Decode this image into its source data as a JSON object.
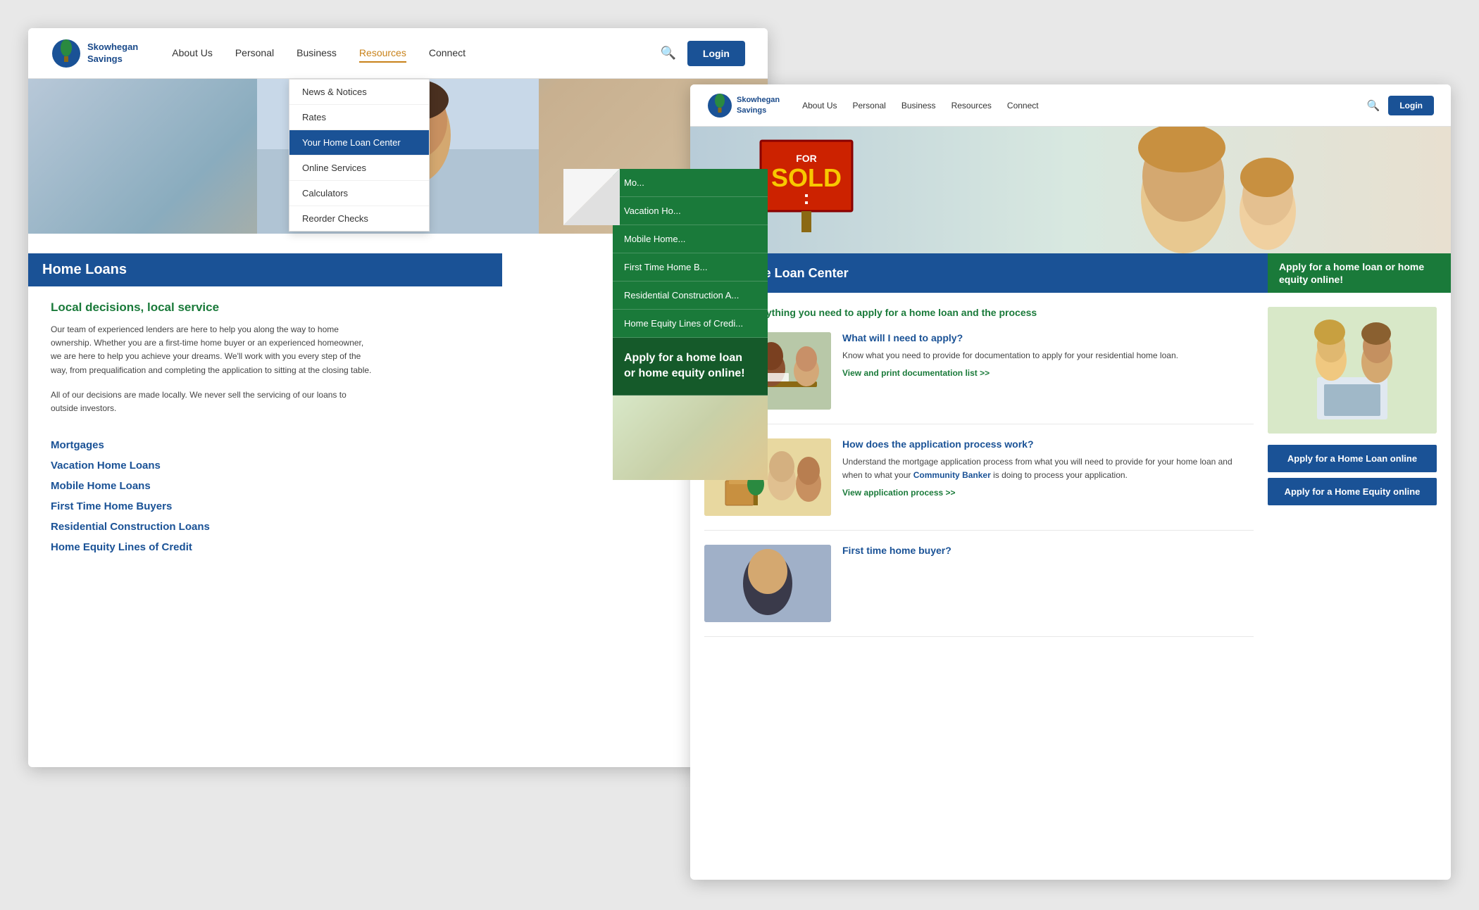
{
  "left_screenshot": {
    "nav": {
      "logo_line1": "Skowhegan",
      "logo_line2": "Savings",
      "links": [
        "About Us",
        "Personal",
        "Business",
        "Resources",
        "Connect"
      ],
      "active_link": "Resources",
      "login_label": "Login",
      "search_placeholder": "Search"
    },
    "dropdown": {
      "items": [
        "News & Notices",
        "Rates",
        "Your Home Loan Center",
        "Online Services",
        "Calculators",
        "Reorder Checks"
      ],
      "highlighted": "Your Home Loan Center"
    },
    "peek_items": [
      "Mo...",
      "Vacation Ho...",
      "Mobile Home...",
      "First Time Home B...",
      "Residential Construction A...",
      "Home Equity Lines of Credi..."
    ],
    "apply_peek": "Apply for a home loan or home equity online!",
    "content": {
      "banner": "Home Loans",
      "headline": "Local decisions, local service",
      "body1": "Our team of experienced lenders are here to help you along the way to home ownership. Whether you are a first-time home buyer or an experienced homeowner, we are here to help you achieve your dreams. We'll work with you every step of the way, from prequalification and completing the application to sitting at the closing table.",
      "body2": "All of our decisions are made locally.  We never sell the servicing of our loans to outside investors.",
      "links": [
        "Mortgages",
        "Vacation Home Loans",
        "Mobile Home Loans",
        "First Time Home Buyers",
        "Residential Construction Loans",
        "Home Equity Lines of Credit"
      ]
    }
  },
  "right_screenshot": {
    "nav": {
      "logo_line1": "Skowhegan",
      "logo_line2": "Savings",
      "links": [
        "About Us",
        "Personal",
        "Business",
        "Resources",
        "Connect"
      ],
      "login_label": "Login"
    },
    "banner": {
      "title": "Your Home Loan Center",
      "apply_text": "Apply for a home loan or home equity online!"
    },
    "find_out": "Find out everything you need to apply for a home loan and the process",
    "cards": [
      {
        "title": "What will I need to apply?",
        "body": "Know what you need to provide for documentation to apply for your residential home loan.",
        "link": "View and print documentation list >>"
      },
      {
        "title": "How does the application process work?",
        "body": "Understand the mortgage application process from what you will need to provide for your home loan and when to what your Community Banker is doing to process your application.",
        "link": "View application process >>"
      },
      {
        "title": "First time home buyer?",
        "body": "",
        "link": ""
      }
    ],
    "sidebar": {
      "apply_home_loan": "Apply for a Home Loan online",
      "apply_home_equity": "Apply for a Home Equity online"
    }
  }
}
